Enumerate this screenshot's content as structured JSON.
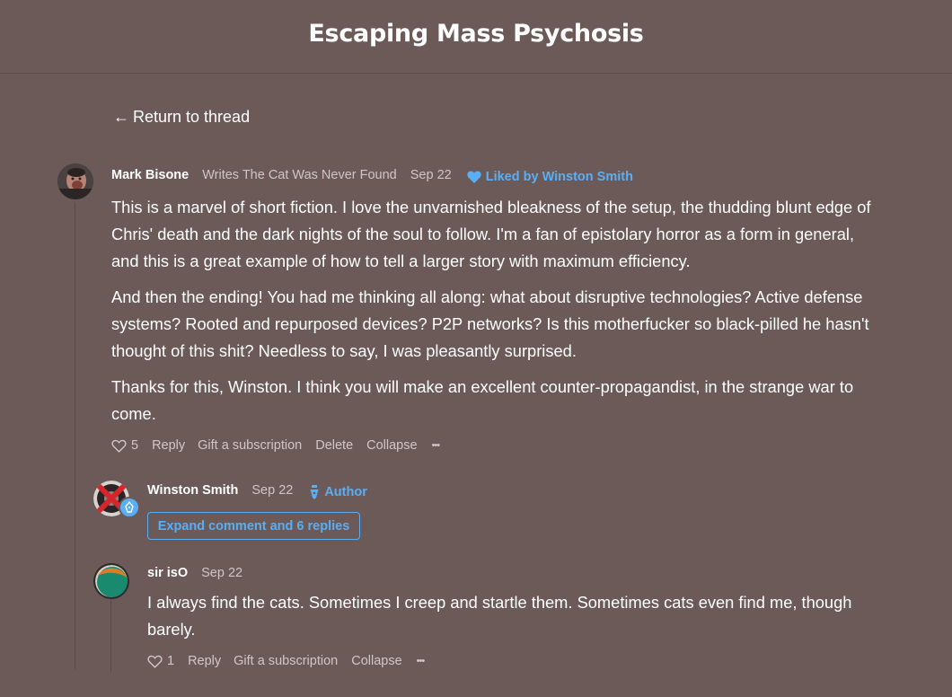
{
  "header": {
    "title": "Escaping Mass Psychosis"
  },
  "nav": {
    "back_arrow": "←",
    "back_label": "Return to thread"
  },
  "comments": [
    {
      "author": "Mark Bisone",
      "byline": "Writes The Cat Was Never Found",
      "date": "Sep 22",
      "liked_by": "Liked by Winston Smith",
      "paragraphs": [
        "This is a marvel of short fiction. I love the unvarnished bleakness of the setup, the thudding blunt edge of Chris' death and the dark nights of the soul to follow. I'm a fan of epistolary horror as a form in general, and this is a great example of how to tell a larger story with maximum efficiency.",
        "And then the ending! You had me thinking all along: what about disruptive technologies? Active defense systems? Rooted and repurposed devices? P2P networks? Is this motherfucker so black-pilled he hasn't thought of this shit? Needless to say, I was pleasantly surprised.",
        "Thanks for this, Winston. I think you will make an excellent counter-propagandist, in the strange war to come."
      ],
      "actions": {
        "likes": "5",
        "reply": "Reply",
        "gift": "Gift a subscription",
        "delete": "Delete",
        "collapse": "Collapse",
        "more": "•••"
      }
    },
    {
      "author": "Winston Smith",
      "date": "Sep 22",
      "badge": "Author",
      "expand_label": "Expand comment and 6 replies"
    },
    {
      "author": "sir isO",
      "date": "Sep 22",
      "paragraphs": [
        "I always find the cats. Sometimes I creep and startle them. Sometimes cats even find me, though barely."
      ],
      "actions": {
        "likes": "1",
        "reply": "Reply",
        "gift": "Gift a subscription",
        "collapse": "Collapse",
        "more": "•••"
      }
    }
  ],
  "colors": {
    "background": "#6b5a58",
    "accent": "#5aaef5",
    "text": "#ffffff",
    "muted": "#d0c7c5"
  },
  "icons": [
    "arrow-left-icon",
    "heart-filled-icon",
    "heart-outline-icon",
    "more-dots-icon",
    "pen-nib-icon"
  ]
}
